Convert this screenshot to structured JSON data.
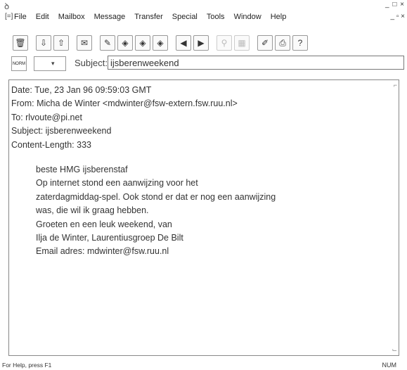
{
  "window": {
    "controls": "_ □ ×",
    "doc_controls": "_ ▫ ×"
  },
  "menu": {
    "items": [
      "File",
      "Edit",
      "Mailbox",
      "Message",
      "Transfer",
      "Special",
      "Tools",
      "Window",
      "Help"
    ]
  },
  "toolbar": {
    "icons": [
      "trash-icon",
      "in-icon",
      "out-icon",
      "envelope-icon",
      "new-message-icon",
      "reply-icon",
      "reply-all-icon",
      "forward-icon",
      "prev-icon",
      "next-icon",
      "attach-icon",
      "filter-icon",
      "address-book-icon",
      "print-icon",
      "help-icon"
    ]
  },
  "subject_bar": {
    "priority_label": "NORM",
    "label": "Subject:",
    "value": "ijsberenweekend"
  },
  "message": {
    "headers": [
      "Date: Tue, 23 Jan 96 09:59:03 GMT",
      "From: Micha de Winter <mdwinter@fsw-extern.fsw.ruu.nl>",
      "To: rlvoute@pi.net",
      "Subject: ijsberenweekend",
      "Content-Length: 333"
    ],
    "body": [
      "beste HMG ijsberenstaf",
      "Op internet stond een aanwijzing voor het",
      "zaterdagmiddag-spel. Ook stond er dat er nog een aanwijzing",
      "was, die wil ik graag hebben.",
      "Groeten en een leuk weekend, van",
      "Ilja de Winter, Laurentiusgroep De Bilt",
      "Email adres: mdwinter@fsw.ruu.nl"
    ]
  },
  "status": {
    "help_text": "For Help, press F1",
    "num": "NUM"
  }
}
